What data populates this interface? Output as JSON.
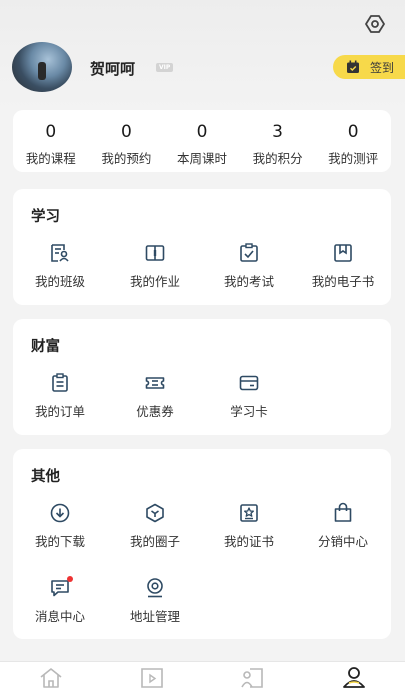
{
  "profile": {
    "name": "贺呵呵",
    "badge": "VIP",
    "signin_label": "签到"
  },
  "stats": [
    {
      "value": "0",
      "label": "我的课程"
    },
    {
      "value": "0",
      "label": "我的预约"
    },
    {
      "value": "0",
      "label": "本周课时"
    },
    {
      "value": "3",
      "label": "我的积分"
    },
    {
      "value": "0",
      "label": "我的测评"
    }
  ],
  "study": {
    "title": "学习",
    "items": [
      {
        "label": "我的班级",
        "icon": "class-icon"
      },
      {
        "label": "我的作业",
        "icon": "homework-icon"
      },
      {
        "label": "我的考试",
        "icon": "exam-icon"
      },
      {
        "label": "我的电子书",
        "icon": "ebook-icon"
      }
    ]
  },
  "wealth": {
    "title": "财富",
    "items": [
      {
        "label": "我的订单",
        "icon": "order-icon"
      },
      {
        "label": "优惠券",
        "icon": "coupon-icon"
      },
      {
        "label": "学习卡",
        "icon": "card-icon"
      }
    ]
  },
  "other": {
    "title": "其他",
    "items": [
      {
        "label": "我的下载",
        "icon": "download-icon"
      },
      {
        "label": "我的圈子",
        "icon": "circle-icon"
      },
      {
        "label": "我的证书",
        "icon": "certificate-icon"
      },
      {
        "label": "分销中心",
        "icon": "distribution-bag-icon"
      },
      {
        "label": "消息中心",
        "icon": "message-icon"
      },
      {
        "label": "地址管理",
        "icon": "location-icon"
      }
    ]
  },
  "tabbar": [
    "home-icon",
    "video-icon",
    "course-icon",
    "profile-icon"
  ],
  "colors": {
    "accent": "#f7d94a",
    "icon": "#2e4a63",
    "notification": "#e33333"
  }
}
